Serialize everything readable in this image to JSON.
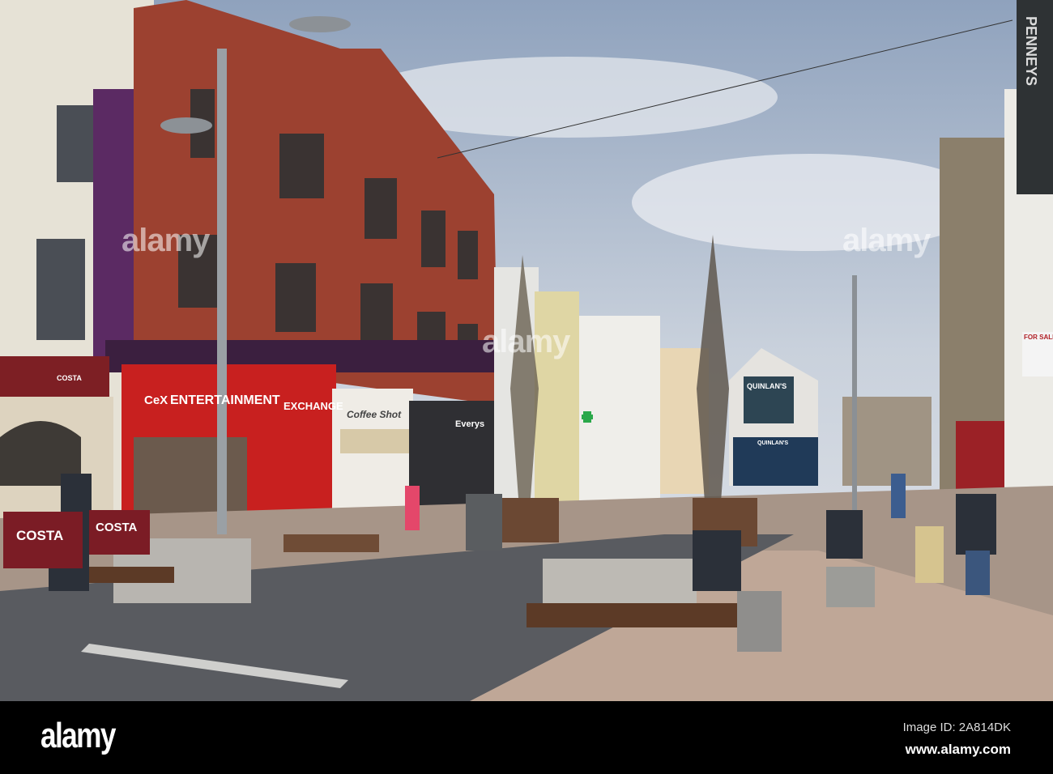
{
  "photo": {
    "description_label": "Pedestrian shopping street with red brick building",
    "signs": {
      "cex_left": "ENTERTAINMENT",
      "cex_right": "EXCHANGE",
      "cex_logo": "CeX",
      "costa_top": "COSTA",
      "costa_board_1": "COSTA",
      "costa_board_2": "COSTA",
      "coffee_shop": "Coffee Shot",
      "everys": "Everys",
      "quinlans": "QUINLAN'S",
      "quinlans_lower": "QUINLAN'S",
      "pennys": "PENNEYS",
      "for_sale": "FOR SALE"
    },
    "watermarks": [
      "alamy",
      "alamy",
      "alamy"
    ]
  },
  "footer": {
    "logo": "alamy",
    "image_id": "Image ID: 2A814DK",
    "website": "www.alamy.com"
  }
}
